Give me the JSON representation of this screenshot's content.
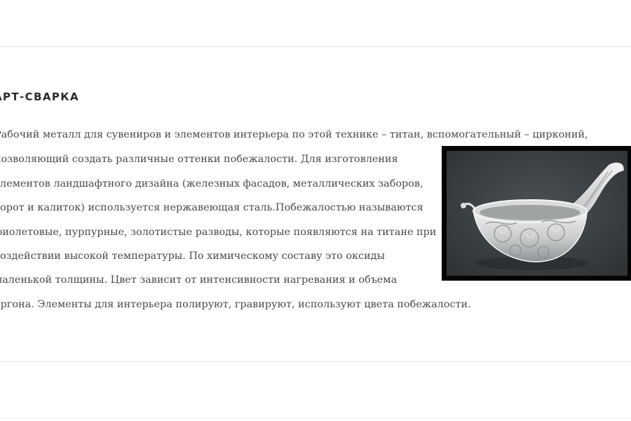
{
  "section": {
    "title": "АРТ-СВАРКА",
    "lines": [
      "Рабочий металл для сувениров и элементов интерьера по этой технике – титан, вспомогательный – цирконий,",
      "позволяющий создать различные оттенки побежалости. Для изготовления",
      "элементов ландшафтного дизайна (железных фасадов, металлических заборов,",
      "ворот и калиток) используется нержавеющая сталь.Побежалостью называются",
      "фиолетовые, пурпурные, золотистые разводы, которые появляются на титане при",
      "воздействии высокой температуры. По химическому составу это оксиды",
      "маленькой толщины. Цвет зависит от интенсивности нагревания и объема",
      "аргона. Элементы для интерьера полируют, гравируют, используют цвета побежалости."
    ]
  },
  "image": {
    "subject": "silver-filigree-kovsh",
    "frame_color": "#050505",
    "backdrop_color": "#3c4144"
  }
}
